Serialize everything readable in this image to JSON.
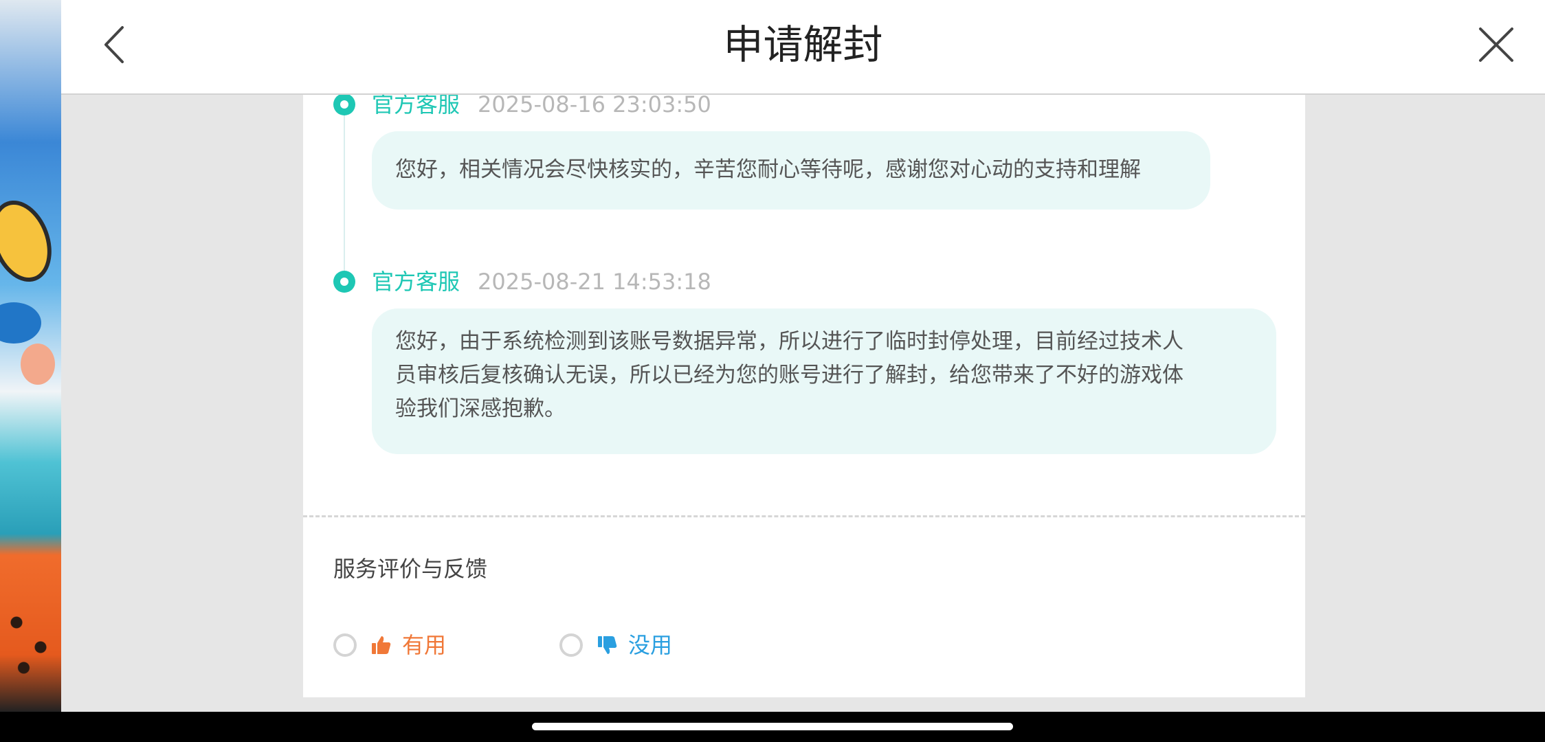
{
  "header": {
    "title": "申请解封"
  },
  "messages": [
    {
      "sender": "官方客服",
      "time": "2025-08-16 23:03:50",
      "text": "您好，相关情况会尽快核实的，辛苦您耐心等待呢，感谢您对心动的支持和理解"
    },
    {
      "sender": "官方客服",
      "time": "2025-08-21 14:53:18",
      "lines": [
        "您好，由于系统检测到该账号数据异常，所以进行了临时封停处理，目前经过技术人",
        "员审核后复核确认无误，所以已经为您的账号进行了解封，给您带来了不好的游戏体",
        "验我们深感抱歉。"
      ]
    }
  ],
  "feedback": {
    "title": "服务评价与反馈",
    "useful_label": "有用",
    "useless_label": "没用"
  },
  "colors": {
    "accent": "#1ec7b4",
    "bubble": "#e9f8f7",
    "useful": "#f07838",
    "useless": "#2a9fe0"
  }
}
